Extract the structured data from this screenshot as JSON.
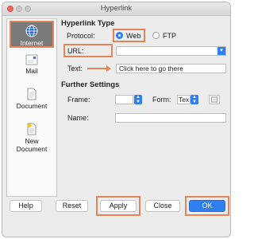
{
  "window": {
    "title": "Hyperlink"
  },
  "sidebar": {
    "items": [
      {
        "label": "Internet",
        "icon": "globe-icon",
        "selected": true
      },
      {
        "label": "Mail",
        "icon": "envelope-icon",
        "selected": false
      },
      {
        "label": "Document",
        "icon": "document-icon",
        "selected": false
      },
      {
        "label": "New\nDocument",
        "icon": "new-document-icon",
        "selected": false
      }
    ]
  },
  "hyperlink_type": {
    "section_title": "Hyperlink Type",
    "protocol_label": "Protocol:",
    "protocol_options": [
      "Web",
      "FTP"
    ],
    "protocol_selected": "Web",
    "url_label": "URL:",
    "url_value": "",
    "text_label": "Text:",
    "text_value": "Click here to go there"
  },
  "further_settings": {
    "section_title": "Further Settings",
    "frame_label": "Frame:",
    "frame_value": "",
    "form_label": "Form:",
    "form_value": "Tex",
    "name_label": "Name:",
    "name_value": ""
  },
  "buttons": {
    "help": "Help",
    "reset": "Reset",
    "apply": "Apply",
    "close": "Close",
    "ok": "OK"
  },
  "colors": {
    "accent": "#2f7ff0",
    "highlight": "#e3855a",
    "selected_sidebar": "#7a7a7a"
  }
}
